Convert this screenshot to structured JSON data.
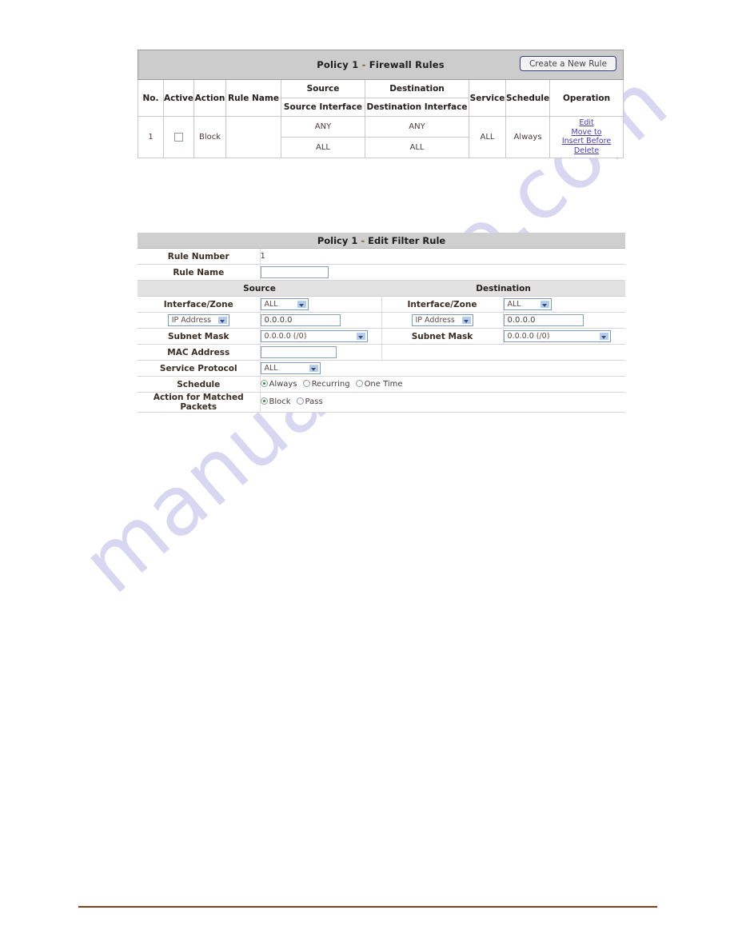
{
  "watermark": {
    "text": "manualshive.com"
  },
  "firewall_rules": {
    "title_prefix": "Policy 1",
    "title_dash": " - ",
    "title_suffix": "Firewall Rules",
    "create_button": "Create a New Rule",
    "headers": {
      "no": "No.",
      "active": "Active",
      "action": "Action",
      "rule_name": "Rule Name",
      "source": "Source",
      "destination": "Destination",
      "source_interface": "Source Interface",
      "destination_interface": "Destination Interface",
      "service": "Service",
      "schedule": "Schedule",
      "operation": "Operation"
    },
    "rows": [
      {
        "no": "1",
        "active_checked": false,
        "action": "Block",
        "rule_name": "",
        "source": "ANY",
        "destination": "ANY",
        "source_interface": "ALL",
        "destination_interface": "ALL",
        "service": "ALL",
        "schedule": "Always",
        "operations": [
          "Edit",
          "Move to",
          "Insert Before",
          "Delete"
        ]
      }
    ]
  },
  "edit_filter_rule": {
    "title_prefix": "Policy 1",
    "title_dash": " - ",
    "title_suffix": "Edit Filter Rule",
    "labels": {
      "rule_number": "Rule Number",
      "rule_name": "Rule Name",
      "source": "Source",
      "destination": "Destination",
      "interface_zone": "Interface/Zone",
      "subnet_mask": "Subnet Mask",
      "mac_address": "MAC Address",
      "service_protocol": "Service Protocol",
      "schedule": "Schedule",
      "action_for_matched_packets": "Action for Matched Packets"
    },
    "values": {
      "rule_number": "1",
      "rule_name": "",
      "mac_address": "",
      "service_protocol": "ALL"
    },
    "source": {
      "interface_zone": "ALL",
      "address_type": "IP Address",
      "ip_address": "0.0.0.0",
      "subnet_mask": "0.0.0.0 (/0)"
    },
    "destination": {
      "interface_zone": "ALL",
      "address_type": "IP Address",
      "ip_address": "0.0.0.0",
      "subnet_mask": "0.0.0.0 (/0)"
    },
    "schedule_options": [
      {
        "label": "Always",
        "selected": true
      },
      {
        "label": "Recurring",
        "selected": false
      },
      {
        "label": "One Time",
        "selected": false
      }
    ],
    "action_options": [
      {
        "label": "Block",
        "selected": true
      },
      {
        "label": "Pass",
        "selected": false
      }
    ]
  }
}
